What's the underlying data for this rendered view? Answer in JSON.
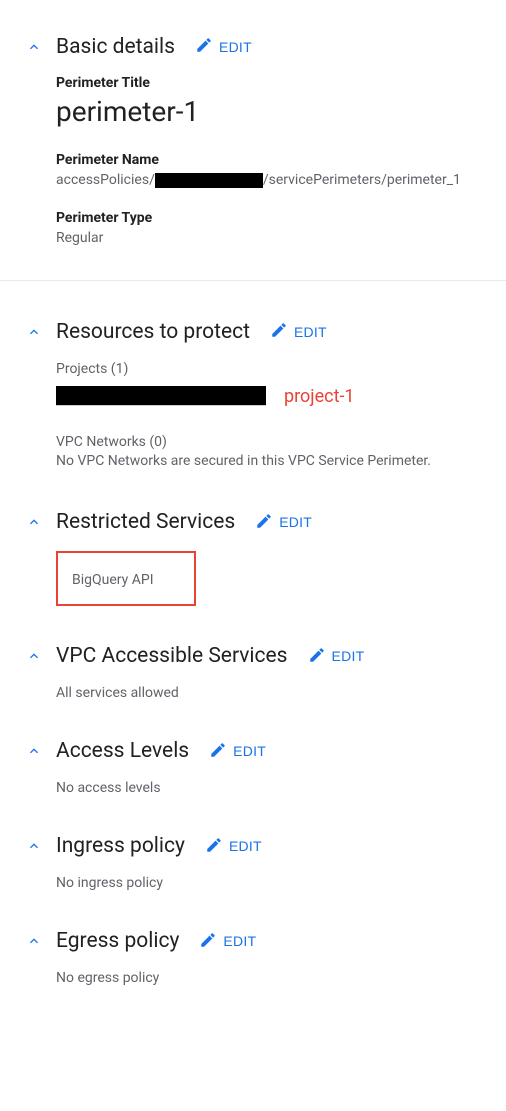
{
  "edit_label": "EDIT",
  "basic_details": {
    "title": "Basic details",
    "perimeter_title_label": "Perimeter Title",
    "perimeter_title_value": "perimeter-1",
    "perimeter_name_label": "Perimeter Name",
    "perimeter_name_prefix": "accessPolicies/",
    "perimeter_name_suffix": "/servicePerimeters/perimeter_1",
    "perimeter_type_label": "Perimeter Type",
    "perimeter_type_value": "Regular"
  },
  "resources": {
    "title": "Resources to protect",
    "projects_label": "Projects (1)",
    "project_name": "project-1",
    "vpc_networks_label": "VPC Networks (0)",
    "vpc_networks_text": "No VPC Networks are secured in this VPC Service Perimeter."
  },
  "restricted_services": {
    "title": "Restricted Services",
    "item": "BigQuery API"
  },
  "vpc_accessible": {
    "title": "VPC Accessible Services",
    "text": "All services allowed"
  },
  "access_levels": {
    "title": "Access Levels",
    "text": "No access levels"
  },
  "ingress": {
    "title": "Ingress policy",
    "text": "No ingress policy"
  },
  "egress": {
    "title": "Egress policy",
    "text": "No egress policy"
  }
}
